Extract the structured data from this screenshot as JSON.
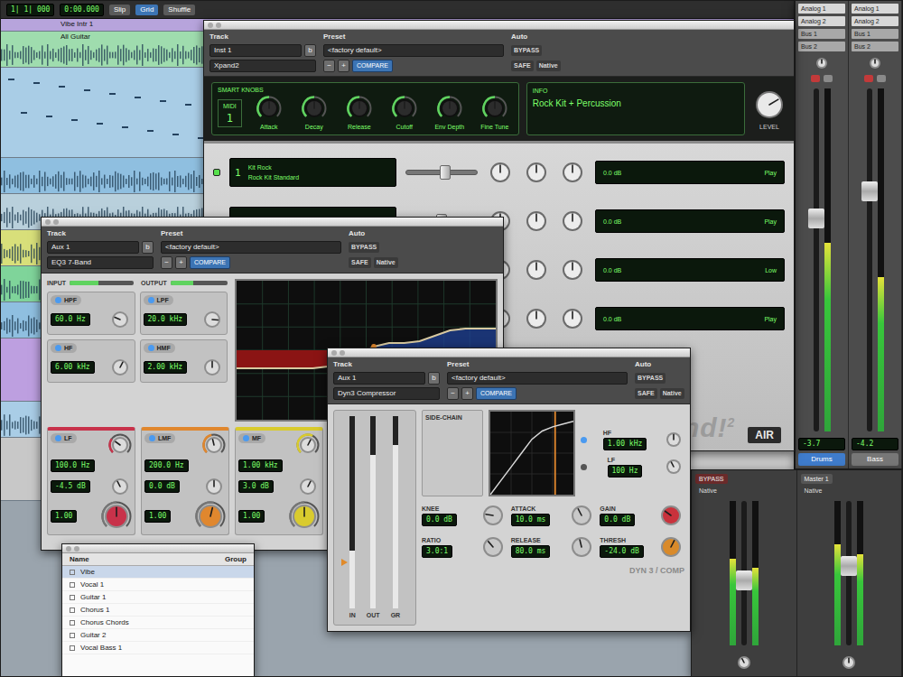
{
  "toolbar": {
    "counter": "1| 1| 000",
    "sub_counter": "0:00.000",
    "buttons": [
      {
        "label": "Slip",
        "selected": false
      },
      {
        "label": "Grid",
        "selected": true
      },
      {
        "label": "Shuffle",
        "selected": false
      }
    ]
  },
  "edit_window": {
    "lanes": [
      {
        "name": "Vibe Intr 1",
        "color": "#b7a4dc",
        "kind": "thin"
      },
      {
        "name": "All Guitar",
        "color": "#9fdcae",
        "kind": "wave"
      },
      {
        "color": "#a9cde6",
        "kind": "midi"
      },
      {
        "color": "#8fbfe0",
        "kind": "wave"
      },
      {
        "color": "#b9d0dc",
        "kind": "wave"
      },
      {
        "color": "#d8df7a",
        "kind": "wave"
      },
      {
        "color": "#7fd49a",
        "kind": "wave"
      },
      {
        "color": "#8fbfe0",
        "kind": "wave"
      },
      {
        "color": "#bd9fe0",
        "kind": "block"
      },
      {
        "color": "#a9cde6",
        "kind": "wave"
      },
      {
        "color": "#c8c8c8",
        "kind": "block"
      }
    ]
  },
  "mixer": {
    "strips": [
      {
        "inserts": [
          "Analog 1",
          "Analog 2"
        ],
        "sends": [
          "Bus 1",
          "Bus 2"
        ],
        "pan": 0.5,
        "fader": 0.62,
        "meter": 0.55,
        "volume": "-3.7",
        "name": "Drums",
        "selected": true
      },
      {
        "inserts": [
          "Analog 1",
          "Analog 2"
        ],
        "sends": [
          "Bus 1",
          "Bus 2"
        ],
        "pan": 0.5,
        "fader": 0.7,
        "meter": 0.45,
        "volume": "-4.2",
        "name": "Bass",
        "selected": false
      }
    ]
  },
  "xpand": {
    "header": {
      "track_label": "Track",
      "preset_label": "Preset",
      "auto_label": "Auto",
      "track": "Inst 1",
      "track_letter": "b",
      "preset": "<factory default>",
      "bypass": "BYPASS",
      "plugin": "Xpand2",
      "prev": "−",
      "next": "+",
      "compare": "COMPARE",
      "safe": "SAFE",
      "native": "Native"
    },
    "smart_title": "SMART KNOBS",
    "midi_label": "MIDI",
    "midi_channel": "1",
    "smart_knobs": [
      {
        "label": "Attack",
        "level": 0.5
      },
      {
        "label": "Decay",
        "level": 0.5
      },
      {
        "label": "Release",
        "level": 0.5
      },
      {
        "label": "Cutoff",
        "level": 0.5
      },
      {
        "label": "Env Depth",
        "level": 0.5
      },
      {
        "label": "Fine Tune",
        "level": 0.5
      }
    ],
    "info_title": "INFO",
    "patch": "Rock Kit + Percussion",
    "level_label": "LEVEL",
    "level": 0.72,
    "parts": [
      {
        "number": "1",
        "name": "Kit Rock",
        "sub": "Rock Kit Standard",
        "on": true,
        "fader": 0.55,
        "knobs": [
          0.5,
          0.5,
          0.5
        ],
        "values": [
          "0.0 dB",
          "Play"
        ]
      },
      {
        "on": true,
        "fader": 0.5,
        "knobs": [
          0.5,
          0.5,
          0.5
        ],
        "values": [
          "0.0 dB",
          "Play"
        ]
      },
      {
        "on": true,
        "fader": 0.5,
        "knobs": [
          0.5,
          0.5,
          0.5
        ],
        "values": [
          "0.0 dB",
          "Low"
        ]
      },
      {
        "on": true,
        "fader": 0.5,
        "knobs": [
          0.5,
          0.5,
          0.5
        ],
        "values": [
          "0.0 dB",
          "Play"
        ]
      }
    ],
    "logo": "Xpand!",
    "logo_sup": "2",
    "brand": "AIR"
  },
  "eq": {
    "header": {
      "track_label": "Track",
      "preset_label": "Preset",
      "auto_label": "Auto",
      "track": "Aux 1",
      "track_letter": "b",
      "preset": "<factory default>",
      "bypass": "BYPASS",
      "plugin": "EQ3 7-Band",
      "prev": "−",
      "next": "+",
      "compare": "COMPARE",
      "safe": "SAFE",
      "native": "Native"
    },
    "input_label": "INPUT",
    "input_level": 0.45,
    "output_label": "OUTPUT",
    "output_level": 0.4,
    "filters": [
      {
        "label": "HPF",
        "value": "60.0 Hz",
        "level": 0.25,
        "on": true
      },
      {
        "label": "LPF",
        "value": "20.0 kHz",
        "level": 0.85,
        "on": true
      },
      {
        "label": "HF",
        "value": "6.00 kHz",
        "level": 0.6,
        "on": true
      },
      {
        "label": "HMF",
        "value": "2.00 kHz",
        "level": 0.5,
        "on": true
      }
    ],
    "bands": [
      {
        "label": "LF",
        "color": "#c8324a",
        "freq": "100.0 Hz",
        "gain": "-4.5 dB",
        "q": "1.00",
        "freq_level": 0.3,
        "gain_level": 0.4,
        "q_level": 0.5
      },
      {
        "label": "LMF",
        "color": "#e0872e",
        "freq": "200.0 Hz",
        "gain": "0.0 dB",
        "q": "1.00",
        "freq_level": 0.45,
        "gain_level": 0.5,
        "q_level": 0.55
      },
      {
        "label": "MF",
        "color": "#d9cb2e",
        "freq": "1.00 kHz",
        "gain": "3.0 dB",
        "q": "1.00",
        "freq_level": 0.6,
        "gain_level": 0.6,
        "q_level": 0.5
      }
    ],
    "curve": [
      -5,
      -5,
      -5,
      -5,
      -5,
      -5,
      -4.5,
      -3,
      -1,
      1,
      2,
      2,
      2.5,
      4,
      5.5,
      6,
      6,
      6
    ]
  },
  "dynamics": {
    "header": {
      "track_label": "Track",
      "preset_label": "Preset",
      "auto_label": "Auto",
      "track": "Aux 1",
      "track_letter": "b",
      "preset": "<factory default>",
      "bypass": "BYPASS",
      "plugin": "Dyn3 Compressor",
      "prev": "−",
      "next": "+",
      "compare": "COMPARE",
      "safe": "SAFE",
      "native": "Native"
    },
    "meters": [
      {
        "label": "IN",
        "level": 0.3
      },
      {
        "label": "OUT",
        "level": 0.8
      },
      {
        "label": "GR",
        "level": 0.85
      }
    ],
    "sidechain_label": "SIDE-CHAIN",
    "curve": [
      -60,
      -50,
      -40,
      -30,
      -20,
      -14,
      -11,
      -9,
      -7
    ],
    "threshold": 0.78,
    "filters": [
      {
        "label": "HF",
        "value": "1.00 kHz",
        "level": 0.5,
        "on": true
      },
      {
        "label": "LF",
        "value": "100 Hz",
        "level": 0.4,
        "on": false
      }
    ],
    "knobs": [
      {
        "label": "KNEE",
        "value": "0.0 dB",
        "level": 0.2,
        "color": "#c8c8c8"
      },
      {
        "label": "ATTACK",
        "value": "10.0 ms",
        "level": 0.4,
        "color": "#c8c8c8"
      },
      {
        "label": "GAIN",
        "value": "0.0 dB",
        "level": 0.3,
        "color": "#c9323c"
      },
      {
        "label": "RATIO",
        "value": "3.0:1",
        "level": 0.35,
        "color": "#c8c8c8"
      },
      {
        "label": "RELEASE",
        "value": "80.0 ms",
        "level": 0.45,
        "color": "#c8c8c8"
      },
      {
        "label": "THRESH",
        "value": "-24.0 dB",
        "level": 0.6,
        "color": "#d98a2a"
      }
    ],
    "logo": "DYN 3 / COMP"
  },
  "track_list": {
    "columns": [
      "Name",
      "Group"
    ],
    "rows": [
      {
        "name": "Vibe",
        "selected": true
      },
      {
        "name": "Vocal 1",
        "selected": false
      },
      {
        "name": "Guitar 1",
        "selected": false
      },
      {
        "name": "Chorus 1",
        "selected": false
      },
      {
        "name": "Chorus Chords",
        "selected": false
      },
      {
        "name": "Guitar 2",
        "selected": false
      },
      {
        "name": "Vocal Bass 1",
        "selected": false
      }
    ]
  },
  "aux_mixer": {
    "strips": [
      {
        "label": "BYPASS",
        "insert": "Native",
        "fader": 0.45,
        "meter": 0.6,
        "pan": 0.4,
        "active": true
      },
      {
        "label": "Master 1",
        "insert": "Native",
        "fader": 0.55,
        "meter": 0.7,
        "pan": 0.5,
        "active": false
      }
    ]
  }
}
